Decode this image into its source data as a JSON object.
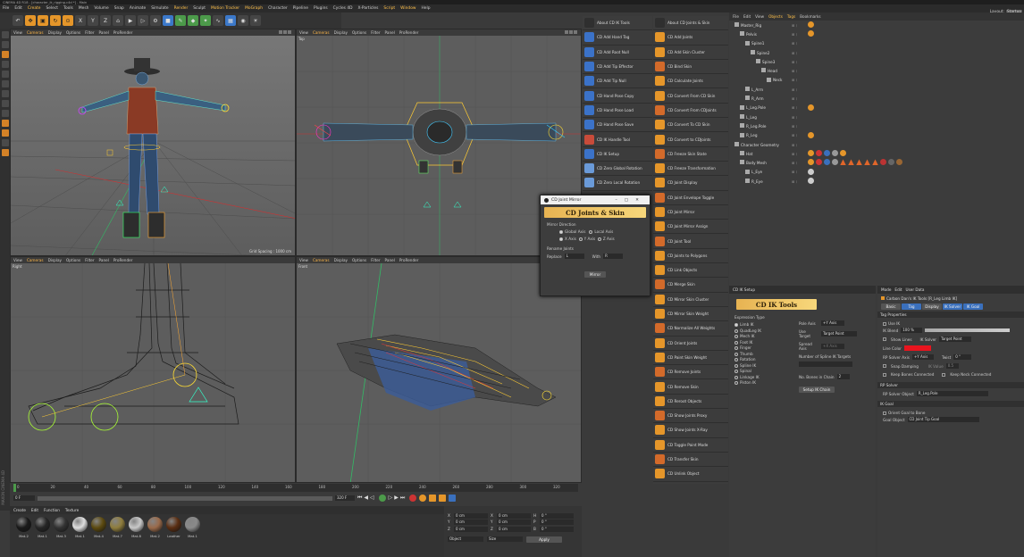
{
  "titlebar": {
    "text": "CINEMA 4D R18 - [character_ik_rigging.c4d *] - Main"
  },
  "menubar": {
    "items": [
      "File",
      "Edit",
      "Create",
      "Select",
      "Tools",
      "Mesh",
      "Volume",
      "Snap",
      "Animate",
      "Simulate",
      "Render",
      "Sculpt",
      "Motion Tracker",
      "MoGraph",
      "Character",
      "Pipeline",
      "Plugins",
      "Cycles 4D",
      "X-Particles",
      "Script",
      "Window",
      "Help"
    ],
    "layout_label": "Layout:",
    "layout_value": "Startup"
  },
  "toolbar": {
    "axes": [
      "X",
      "Y",
      "Z"
    ]
  },
  "viewport_menu": [
    "View",
    "Cameras",
    "Display",
    "Options",
    "Filter",
    "Panel",
    "ProRender"
  ],
  "viewports": {
    "perspective": {
      "label": "Perspective",
      "grid_spacing": "Grid Spacing : 1000 cm"
    },
    "top": {
      "label": "Top"
    },
    "right": {
      "label": "Right"
    },
    "front": {
      "label": "Front"
    }
  },
  "cd_ik_tools": {
    "items": [
      "About CD IK Tools",
      "CD Add Hand Tag",
      "CD Add Root Null",
      "CD Add Tip Effector",
      "CD Add Tip Null",
      "CD Hand Pose Copy",
      "CD Hand Pose Load",
      "CD Hand Pose Save",
      "CD IK Handle Tool",
      "CD IK Setup",
      "CD Zero Global Rotation",
      "CD Zero Local Rotation"
    ],
    "colors": [
      "#2f2f2f",
      "#3b72c8",
      "#3b72c8",
      "#3b72c8",
      "#3b72c8",
      "#3b72c8",
      "#3b72c8",
      "#3b72c8",
      "#c84b3a",
      "#3b72c8",
      "#6a9ad8",
      "#6a9ad8"
    ]
  },
  "cd_joints_skin": {
    "items": [
      "About CD Joints & Skin",
      "CD Add Joints",
      "CD Add Skin Cluster",
      "CD Bind Skin",
      "CD Calculate Joints",
      "CD Convert From CD Skin",
      "CD Convert From CDJoints",
      "CD Convert To CD Skin",
      "CD Convert to CDJoints",
      "CD Freeze Skin State",
      "CD Freeze Transformation",
      "CD Joint Display",
      "CD Joint Envelope Toggle",
      "CD Joint Mirror",
      "CD Joint Mirror Assign",
      "CD Joint Tool",
      "CD Joints to Polygons",
      "CD Link Objects",
      "CD Merge Skin",
      "CD Mirror Skin Cluster",
      "CD Mirror Skin Weight",
      "CD Normalize All Weights",
      "CD Orient Joints",
      "CD Paint Skin Weight",
      "CD Remove Joints",
      "CD Remove Skin",
      "CD Reroot Objects",
      "CD Show Joints Proxy",
      "CD Show Joints X-Ray",
      "CD Toggle Paint Mode",
      "CD Transfer Skin",
      "CD Unlink Object"
    ]
  },
  "joint_mirror": {
    "title": "CD Joint Mirror",
    "banner": "CD Joints & Skin",
    "mirror_direction_label": "Mirror Direction",
    "coord_options": [
      "Global Axis",
      "Local Axis"
    ],
    "axis_options": [
      "X Axis",
      "Y Axis",
      "Z Axis"
    ],
    "rename_label": "Rename Joints",
    "replace_label": "Replace",
    "replace_value": "L",
    "with_label": "With",
    "with_value": "R",
    "button": "Mirror"
  },
  "object_manager": {
    "menu": [
      "File",
      "Edit",
      "View",
      "Objects",
      "Tags",
      "Bookmarks"
    ],
    "rows": [
      {
        "name": "Master_Rig",
        "indent": 0
      },
      {
        "name": "Pelvis",
        "indent": 1
      },
      {
        "name": "Spine1",
        "indent": 2
      },
      {
        "name": "Spine2",
        "indent": 3
      },
      {
        "name": "Spine3",
        "indent": 4
      },
      {
        "name": "Head",
        "indent": 5
      },
      {
        "name": "Neck",
        "indent": 6
      },
      {
        "name": "L_Arm",
        "indent": 2
      },
      {
        "name": "R_Arm",
        "indent": 2
      },
      {
        "name": "L_Leg.Pole",
        "indent": 1
      },
      {
        "name": "L_Leg",
        "indent": 1
      },
      {
        "name": "R_Leg.Pole",
        "indent": 1
      },
      {
        "name": "R_Leg",
        "indent": 1
      },
      {
        "name": "Character Geometry",
        "indent": 0
      },
      {
        "name": "Hat",
        "indent": 1
      },
      {
        "name": "Body Mesh",
        "indent": 1
      },
      {
        "name": "L_Eye",
        "indent": 2
      },
      {
        "name": "R_Eye",
        "indent": 2
      }
    ]
  },
  "ik_setup": {
    "title": "CD IK Setup",
    "banner": "CD IK Tools",
    "expression_label": "Expression Type",
    "types": [
      "Limb IK",
      "QuadLeg IK",
      "Mech IK",
      "Foot IK",
      "Finger",
      "Thumb",
      "Rotation",
      "Spline IK",
      "Spinal",
      "Linkage IK",
      "Piston IK"
    ],
    "pole_axis_label": "Pole Axis",
    "pole_axis_value": "+Y Axis",
    "use_target_label": "Use Target",
    "use_target_value": "Target Point",
    "spread_axis_label": "Spread Axis",
    "spread_axis_value": "+X Axis",
    "spline_targets_label": "Number of Spline IK Targets",
    "bones_label": "No. Bones in Chain",
    "bones_value": "2",
    "button": "Setup IK Chain"
  },
  "attributes": {
    "menu": [
      "Mode",
      "Edit",
      "User Data"
    ],
    "object_line": "Carbon Dan's IK Tools [R_Leg Limb IK]",
    "tabs": [
      "Basic",
      "Tag",
      "Display",
      "IK Solver",
      "IK Goal"
    ],
    "tag_props": "Tag Properties",
    "use_ik": "Use IK",
    "ik_blend_label": "IK Blend",
    "ik_blend_value": "100 %",
    "show_lines": "Show Lines",
    "ik_solver": "IK Solver",
    "ik_solver_value": "Target Point",
    "line_color": "Line Color",
    "solver_axis": "RP Solver Axis",
    "solver_axis_value": "+Y Axis",
    "twist": "Twist",
    "twist_value": "0 °",
    "snap_damping": "Snap Damping",
    "ik_value": "IK Value",
    "ik_value_num": "0.5",
    "keep_bones": "Keep Bones Connected",
    "keep_neck": "Keep Neck Connected",
    "rp_solver": "RP Solver",
    "pole_object_label": "RP Solver Object",
    "pole_object_value": "R_Leg.Pole",
    "ik_goal": "IK Goal",
    "orient_goal": "Orient Goal to Bone",
    "goal_object_label": "Goal Object",
    "goal_object_value": "CD Joint Tip Goal",
    "line_color_hex": "#e8141e"
  },
  "timeline": {
    "ticks": [
      "0",
      "20",
      "40",
      "60",
      "80",
      "100",
      "120",
      "140",
      "160",
      "180",
      "200",
      "220",
      "240",
      "260",
      "280",
      "300",
      "320"
    ],
    "start": "0 F",
    "end": "320 F",
    "current": "0 F"
  },
  "materials": {
    "menu": [
      "Create",
      "Edit",
      "Function",
      "Texture"
    ],
    "items": [
      "Mat.2",
      "Mat.1",
      "Mat.3",
      "Mat.1",
      "Mat.4",
      "Mat.7",
      "Mat.8",
      "Mat.2",
      "Leather",
      "Mat.1"
    ],
    "colors": [
      "#1a1a1a",
      "#262626",
      "#333",
      "#dedede",
      "#5c4a10",
      "#8f7d3d",
      "#c9c9c9",
      "#9a6a4a",
      "#5a2e12",
      "#8a8a8a"
    ]
  },
  "coordinates": {
    "rows": [
      [
        "X",
        "0 cm",
        "X",
        "0 cm",
        "H",
        "0 °"
      ],
      [
        "Y",
        "0 cm",
        "Y",
        "0 cm",
        "P",
        "0 °"
      ],
      [
        "Z",
        "0 cm",
        "Z",
        "0 cm",
        "B",
        "0 °"
      ]
    ],
    "mode": "Object",
    "size_mode": "Size",
    "apply": "Apply"
  },
  "side_brand": "MAXON CINEMA 4D"
}
